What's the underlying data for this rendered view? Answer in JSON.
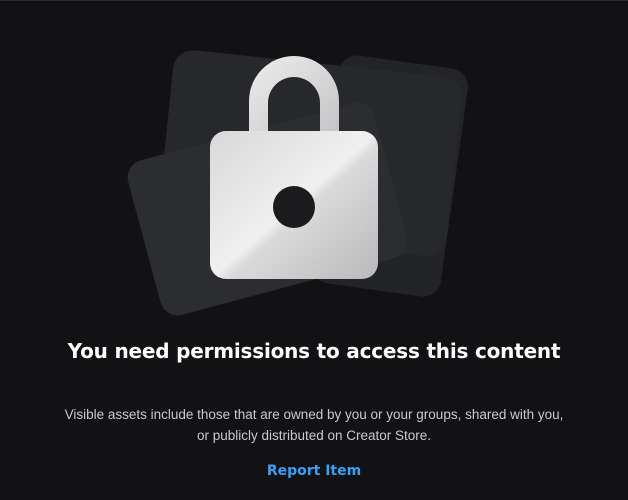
{
  "permission_notice": {
    "title": "You need permissions to access this content",
    "description": "Visible assets include those that are owned by you or your groups, shared with you, or publicly distributed on Creator Store.",
    "report_link": "Report Item"
  },
  "icons": {
    "illustration": "lock-icon"
  },
  "colors": {
    "background": "#121215",
    "card_back": "#232428",
    "card_front": "#2c2d31",
    "title": "#ffffff",
    "description": "#c9cace",
    "link": "#3aa0f5"
  }
}
